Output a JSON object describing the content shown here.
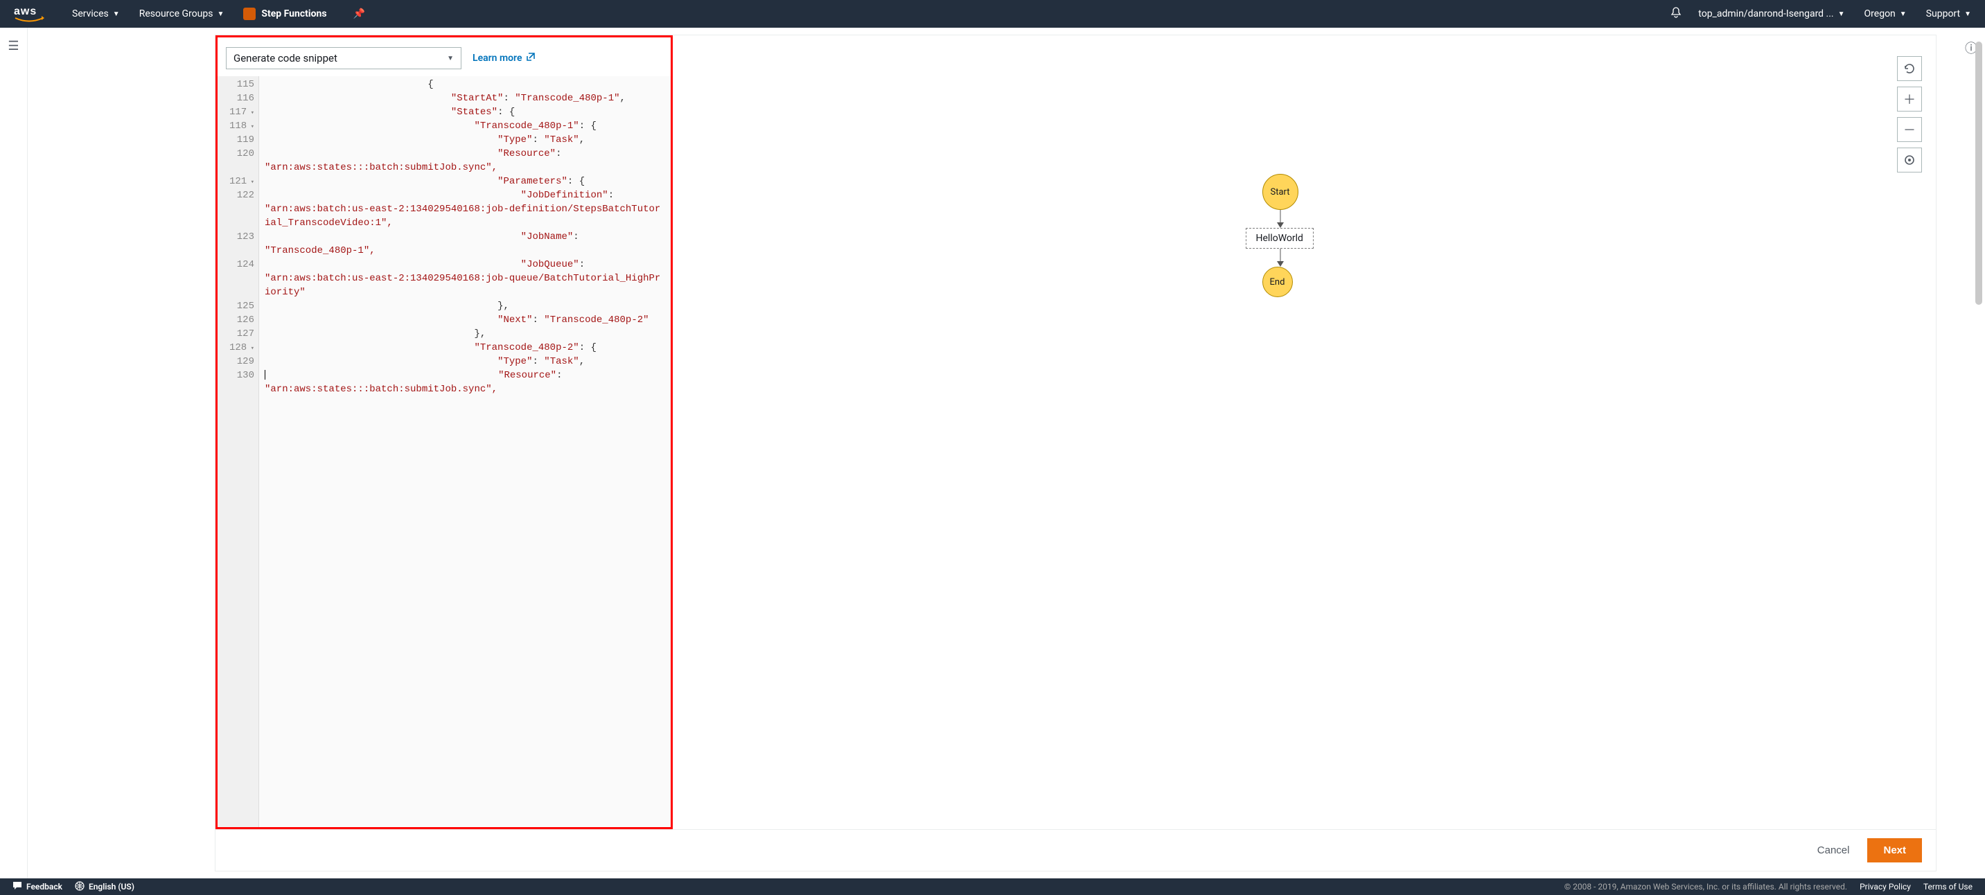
{
  "topnav": {
    "logo_text": "aws",
    "services": "Services",
    "resource_groups": "Resource Groups",
    "service_name": "Step Functions",
    "account": "top_admin/danrond-Isengard ...",
    "region": "Oregon",
    "support": "Support"
  },
  "editor": {
    "dropdown_label": "Generate code snippet",
    "learn_more": "Learn more"
  },
  "code": {
    "lines": [
      {
        "n": "115",
        "fold": false,
        "indent": 28,
        "tokens": [
          {
            "t": "pn",
            "v": "{"
          }
        ]
      },
      {
        "n": "116",
        "fold": false,
        "indent": 32,
        "tokens": [
          {
            "t": "key",
            "v": "\"StartAt\""
          },
          {
            "t": "pn",
            "v": ": "
          },
          {
            "t": "str",
            "v": "\"Transcode_480p-1\""
          },
          {
            "t": "pn",
            "v": ","
          }
        ]
      },
      {
        "n": "117",
        "fold": true,
        "indent": 32,
        "tokens": [
          {
            "t": "key",
            "v": "\"States\""
          },
          {
            "t": "pn",
            "v": ": {"
          }
        ]
      },
      {
        "n": "118",
        "fold": true,
        "indent": 36,
        "tokens": [
          {
            "t": "key",
            "v": "\"Transcode_480p-1\""
          },
          {
            "t": "pn",
            "v": ": {"
          }
        ]
      },
      {
        "n": "119",
        "fold": false,
        "indent": 40,
        "tokens": [
          {
            "t": "key",
            "v": "\"Type\""
          },
          {
            "t": "pn",
            "v": ": "
          },
          {
            "t": "str",
            "v": "\"Task\""
          },
          {
            "t": "pn",
            "v": ","
          }
        ]
      },
      {
        "n": "120",
        "fold": false,
        "indent": 40,
        "tokens": [
          {
            "t": "key",
            "v": "\"Resource\""
          },
          {
            "t": "pn",
            "v": ": "
          }
        ],
        "wrap": "\"arn:aws:states:::batch:submitJob.sync\","
      },
      {
        "n": "121",
        "fold": true,
        "indent": 40,
        "tokens": [
          {
            "t": "key",
            "v": "\"Parameters\""
          },
          {
            "t": "pn",
            "v": ": {"
          }
        ]
      },
      {
        "n": "122",
        "fold": false,
        "indent": 44,
        "tokens": [
          {
            "t": "key",
            "v": "\"JobDefinition\""
          },
          {
            "t": "pn",
            "v": ": "
          }
        ],
        "wrap": "\"arn:aws:batch:us-east-2:134029540168:job-definition/StepsBatchTutorial_TranscodeVideo:1\","
      },
      {
        "n": "123",
        "fold": false,
        "indent": 44,
        "tokens": [
          {
            "t": "key",
            "v": "\"JobName\""
          },
          {
            "t": "pn",
            "v": ": "
          }
        ],
        "wrap": "\"Transcode_480p-1\","
      },
      {
        "n": "124",
        "fold": false,
        "indent": 44,
        "tokens": [
          {
            "t": "key",
            "v": "\"JobQueue\""
          },
          {
            "t": "pn",
            "v": ": "
          }
        ],
        "wrap": "\"arn:aws:batch:us-east-2:134029540168:job-queue/BatchTutorial_HighPriority\""
      },
      {
        "n": "125",
        "fold": false,
        "indent": 40,
        "tokens": [
          {
            "t": "pn",
            "v": "},"
          }
        ]
      },
      {
        "n": "126",
        "fold": false,
        "indent": 40,
        "tokens": [
          {
            "t": "key",
            "v": "\"Next\""
          },
          {
            "t": "pn",
            "v": ": "
          },
          {
            "t": "str",
            "v": "\"Transcode_480p-2\""
          }
        ]
      },
      {
        "n": "127",
        "fold": false,
        "indent": 36,
        "tokens": [
          {
            "t": "pn",
            "v": "},"
          }
        ]
      },
      {
        "n": "128",
        "fold": true,
        "indent": 36,
        "tokens": [
          {
            "t": "key",
            "v": "\"Transcode_480p-2\""
          },
          {
            "t": "pn",
            "v": ": {"
          }
        ]
      },
      {
        "n": "129",
        "fold": false,
        "indent": 40,
        "tokens": [
          {
            "t": "key",
            "v": "\"Type\""
          },
          {
            "t": "pn",
            "v": ": "
          },
          {
            "t": "str",
            "v": "\"Task\""
          },
          {
            "t": "pn",
            "v": ","
          }
        ]
      },
      {
        "n": "130",
        "fold": false,
        "indent": 40,
        "tokens": [
          {
            "t": "key",
            "v": "\"Resource\""
          },
          {
            "t": "pn",
            "v": ": "
          }
        ],
        "wrap": "\"arn:aws:states:::batch:submitJob.sync\","
      }
    ]
  },
  "graph": {
    "start": "Start",
    "state": "HelloWorld",
    "end": "End"
  },
  "actions": {
    "cancel": "Cancel",
    "next": "Next"
  },
  "footer": {
    "feedback": "Feedback",
    "language": "English (US)",
    "copyright": "© 2008 - 2019, Amazon Web Services, Inc. or its affiliates. All rights reserved.",
    "privacy": "Privacy Policy",
    "terms": "Terms of Use"
  }
}
